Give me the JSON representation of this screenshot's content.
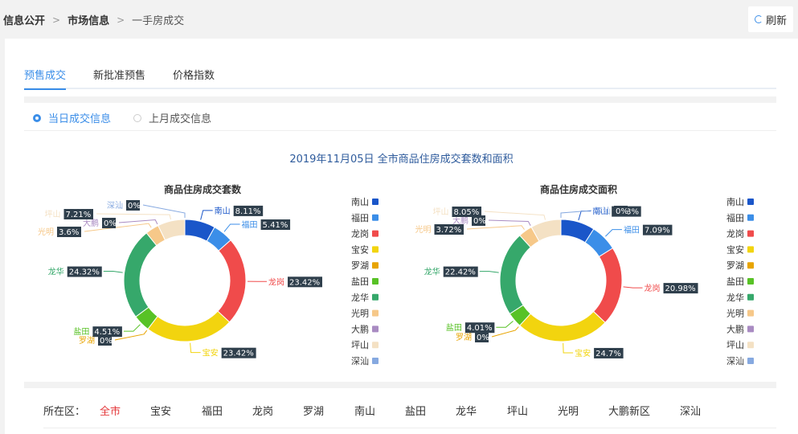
{
  "breadcrumb": {
    "items": [
      "信息公开",
      "市场信息",
      "一手房成交"
    ],
    "separator": ">"
  },
  "refresh_label": "刷新",
  "tabs": [
    "预售成交",
    "新批准预售",
    "价格指数"
  ],
  "radios": {
    "selected": "当日成交信息",
    "other": "上月成交信息"
  },
  "main_title": "2019年11月05日 全市商品住房成交套数和面积",
  "districts": {
    "label": "所在区：",
    "items": [
      "全市",
      "宝安",
      "福田",
      "龙岗",
      "罗湖",
      "南山",
      "盐田",
      "龙华",
      "坪山",
      "光明",
      "大鹏新区",
      "深汕"
    ],
    "active": "全市"
  },
  "colors": {
    "南山": "#1a56c9",
    "福田": "#3b8ee8",
    "龙岗": "#f04b4b",
    "宝安": "#f2d40f",
    "罗湖": "#e8a400",
    "盐田": "#58c226",
    "龙华": "#36a86b",
    "光明": "#f6c889",
    "大鹏": "#a98bc2",
    "坪山": "#f4e1c4",
    "深汕": "#86a9e0"
  },
  "chart_data": [
    {
      "type": "pie",
      "title": "商品住房成交套数",
      "categories": [
        "南山",
        "福田",
        "龙岗",
        "宝安",
        "罗湖",
        "盐田",
        "龙华",
        "光明",
        "大鹏",
        "坪山",
        "深汕"
      ],
      "values": [
        8.11,
        5.41,
        23.42,
        23.42,
        0,
        4.51,
        24.32,
        3.6,
        0,
        7.21,
        0
      ],
      "labels": [
        "8.11%",
        "5.41%",
        "23.42%",
        "23.42%",
        "0%",
        "4.51%",
        "24.32%",
        "3.6%",
        "0%",
        "7.21%",
        "0%"
      ],
      "legend": [
        "南山",
        "福田",
        "龙岗",
        "宝安",
        "罗湖",
        "盐田",
        "龙华",
        "光明",
        "大鹏",
        "坪山",
        "深汕"
      ]
    },
    {
      "type": "pie",
      "title": "商品住房成交面积",
      "categories": [
        "南山",
        "福田",
        "龙岗",
        "宝安",
        "罗湖",
        "盐田",
        "龙华",
        "光明",
        "大鹏",
        "坪山",
        "深汕"
      ],
      "values": [
        9.03,
        7.09,
        20.98,
        24.7,
        0,
        4.01,
        22.42,
        3.72,
        0,
        8.05,
        0
      ],
      "labels": [
        "9.03%",
        "7.09%",
        "20.98%",
        "24.7%",
        "0%",
        "4.01%",
        "22.42%",
        "3.72%",
        "0%",
        "8.05%",
        "0%"
      ],
      "legend": [
        "南山",
        "福田",
        "龙岗",
        "宝安",
        "罗湖",
        "盐田",
        "龙华",
        "光明",
        "大鹏",
        "坪山",
        "深汕"
      ]
    }
  ]
}
